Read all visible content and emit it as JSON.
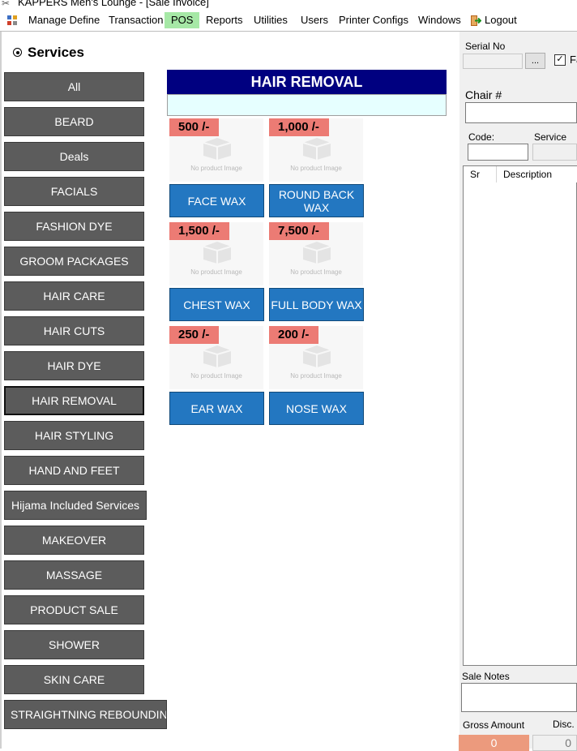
{
  "window": {
    "title": "KAPPERS Men's Lounge - [Sale Invoice]"
  },
  "menu": [
    "Manage Define",
    "Transaction",
    "POS",
    "Reports",
    "Utilities",
    "Users",
    "Printer Configs",
    "Windows",
    "Logout"
  ],
  "services_header": "Services",
  "categories": [
    "All",
    "BEARD",
    "Deals",
    "FACIALS",
    "FASHION DYE",
    "GROOM PACKAGES",
    "HAIR CARE",
    "HAIR CUTS",
    "HAIR DYE",
    "HAIR REMOVAL",
    "HAIR STYLING",
    "HAND AND FEET",
    "Hijama Included Services",
    "MAKEOVER",
    "MASSAGE",
    "PRODUCT SALE",
    "SHOWER",
    "SKIN CARE",
    "STRAIGHTNING  REBOUNDING"
  ],
  "selected_category": "HAIR REMOVAL",
  "group_title": "HAIR REMOVAL",
  "no_image_text": "No product Image",
  "products": [
    {
      "price": "500 /-",
      "name": "FACE WAX"
    },
    {
      "price": "1,000 /-",
      "name": "ROUND BACK WAX"
    },
    {
      "price": "1,500 /-",
      "name": "CHEST WAX"
    },
    {
      "price": "7,500 /-",
      "name": "FULL BODY WAX"
    },
    {
      "price": "250 /-",
      "name": "EAR WAX"
    },
    {
      "price": "200 /-",
      "name": "NOSE WAX"
    }
  ],
  "right": {
    "serial_label": "Serial No",
    "ellipsis": "...",
    "checkbox_label": "Fa",
    "chair_label": "Chair #",
    "code_label": "Code:",
    "service_label": "Service",
    "grid_headers": [
      "Sr",
      "Description"
    ],
    "notes_label": "Sale Notes",
    "gross_label": "Gross Amount",
    "gross_value": "0",
    "disc_label": "Disc.",
    "disc_value": "0"
  }
}
